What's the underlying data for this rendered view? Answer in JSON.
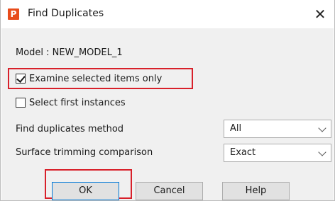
{
  "window": {
    "title": "Find Duplicates",
    "app_icon_letter": "P",
    "close_glyph": "✕"
  },
  "model": {
    "label": "Model : NEW_MODEL_1"
  },
  "options": {
    "examine_selected": {
      "label": "Examine selected items only",
      "checked": true
    },
    "select_first": {
      "label": "Select first instances",
      "checked": false
    }
  },
  "fields": {
    "method": {
      "label": "Find duplicates method",
      "value": "All"
    },
    "trimming": {
      "label": "Surface trimming comparison",
      "value": "Exact"
    }
  },
  "buttons": {
    "ok": "OK",
    "cancel": "Cancel",
    "help": "Help"
  },
  "colors": {
    "highlight": "#d8202a",
    "app_icon": "#e84c1b",
    "content_bg": "#f0f0f0"
  }
}
